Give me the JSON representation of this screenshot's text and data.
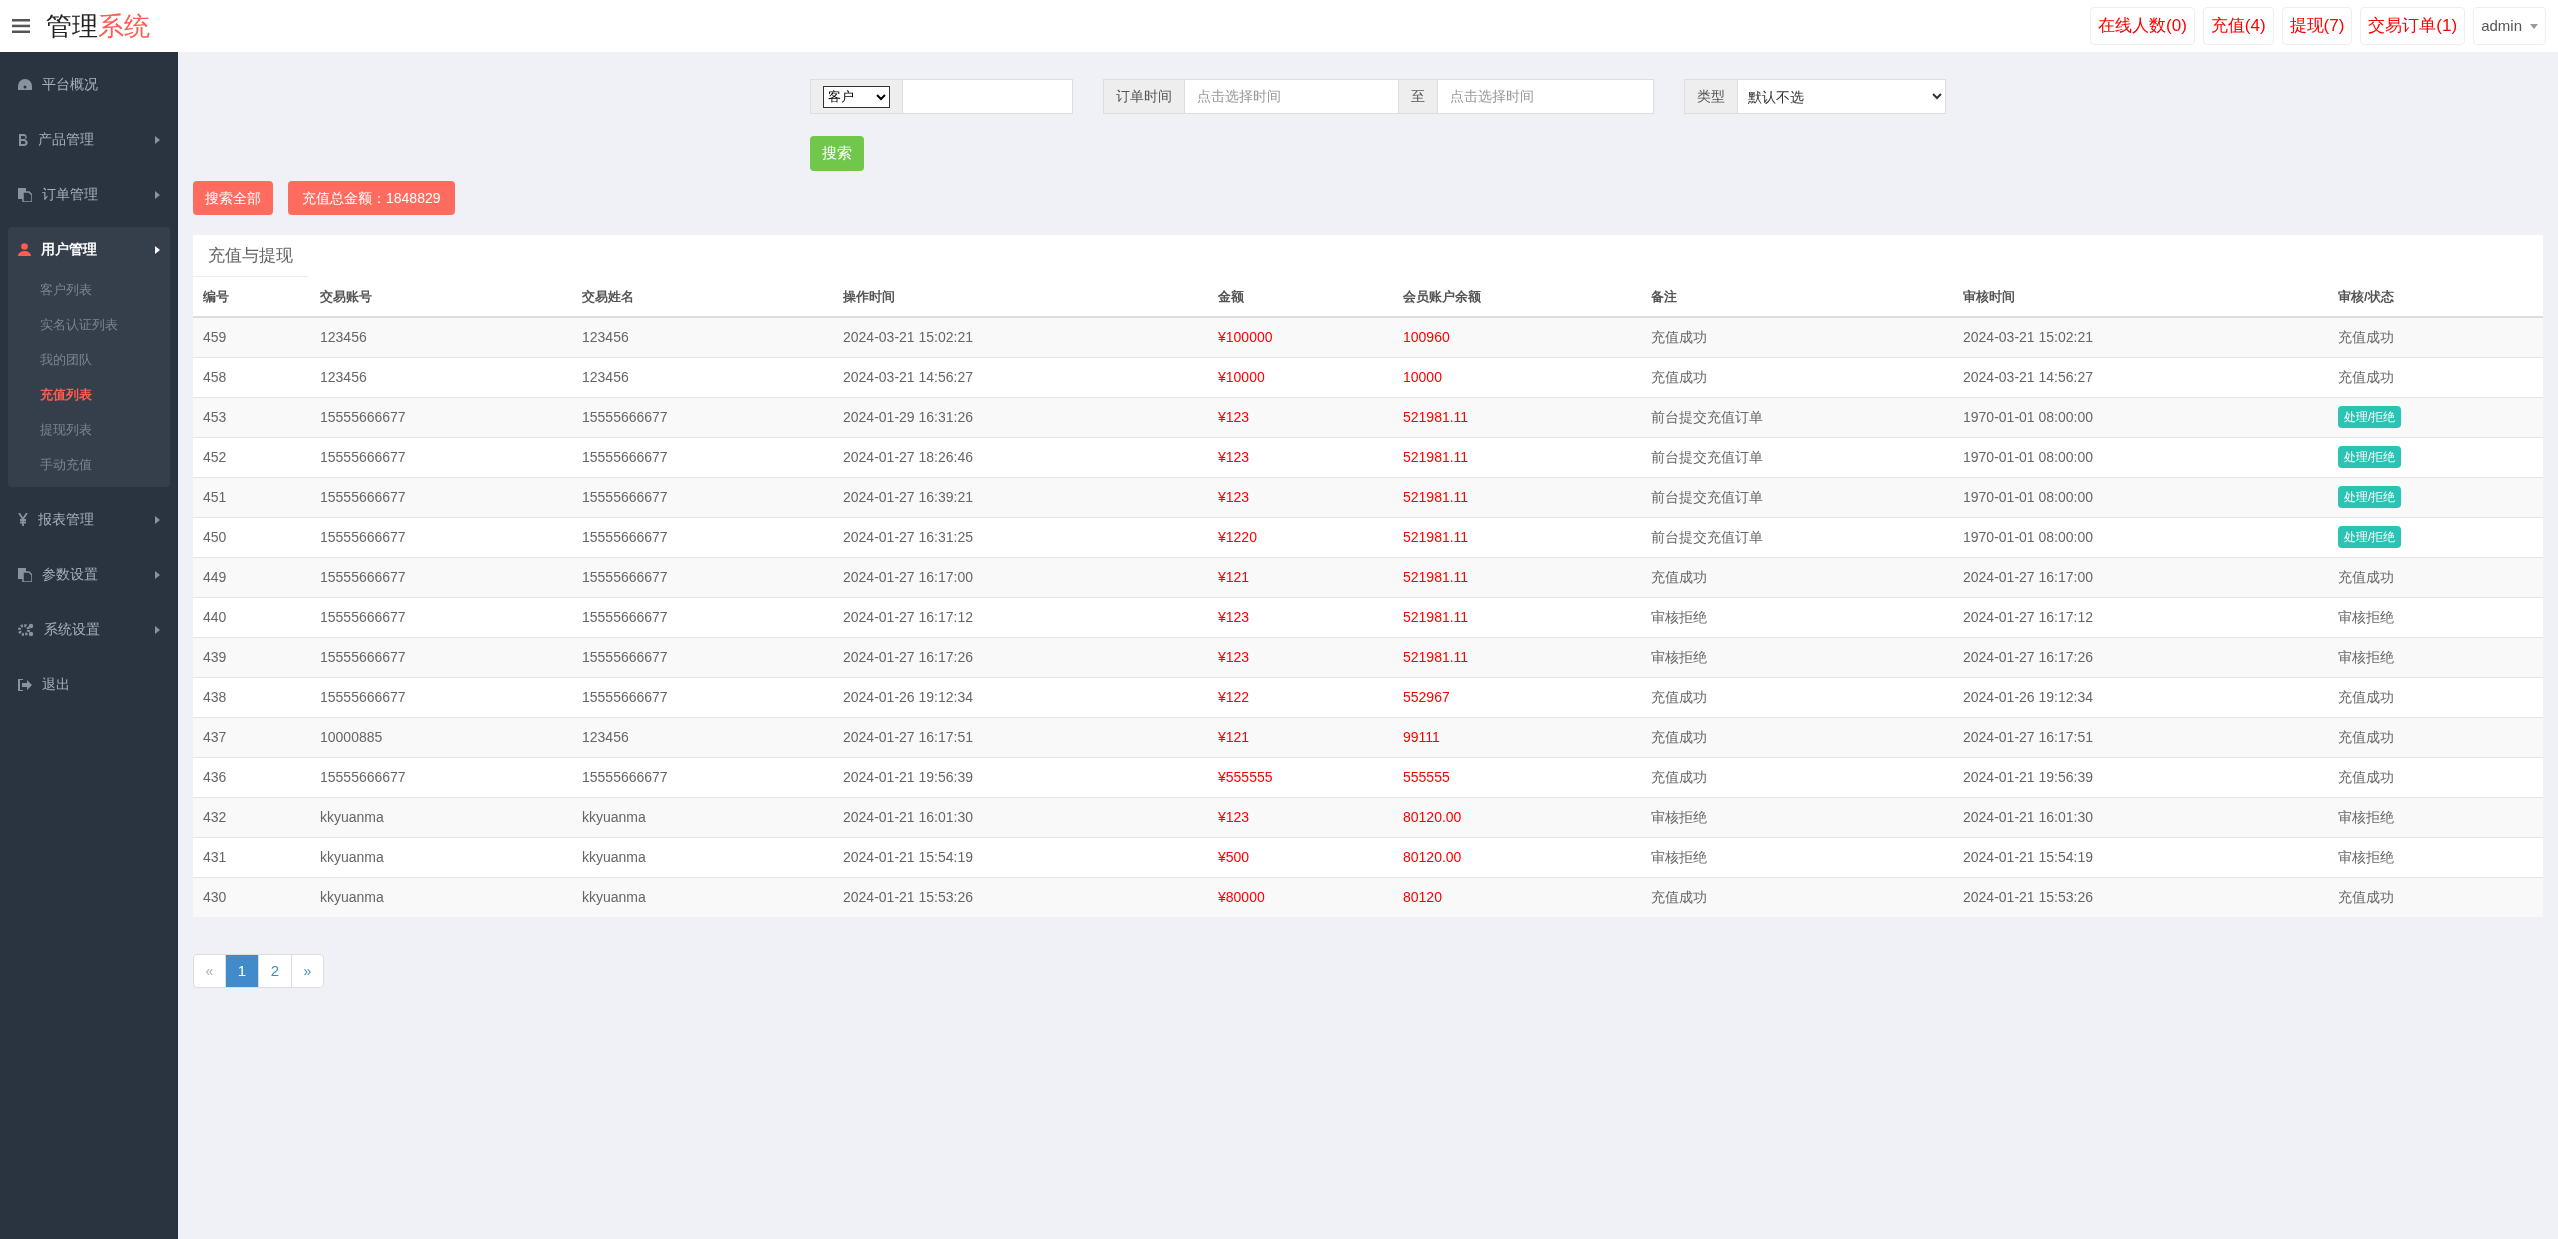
{
  "header": {
    "title_main": "管理",
    "title_accent": "系统",
    "badges": [
      "在线人数(0)",
      "充值(4)",
      "提现(7)",
      "交易订单(1)"
    ],
    "user": "admin"
  },
  "sidebar": {
    "items": [
      {
        "label": "平台概况",
        "kind": "link",
        "expanded": false
      },
      {
        "label": "产品管理",
        "kind": "menu",
        "expanded": false
      },
      {
        "label": "订单管理",
        "kind": "menu",
        "expanded": false
      },
      {
        "label": "用户管理",
        "kind": "menu",
        "expanded": true,
        "children": [
          {
            "label": "客户列表",
            "selected": false
          },
          {
            "label": "实名认证列表",
            "selected": false
          },
          {
            "label": "我的团队",
            "selected": false
          },
          {
            "label": "充值列表",
            "selected": true
          },
          {
            "label": "提现列表",
            "selected": false
          },
          {
            "label": "手动充值",
            "selected": false
          }
        ]
      },
      {
        "label": "报表管理",
        "kind": "menu",
        "expanded": false
      },
      {
        "label": "参数设置",
        "kind": "menu",
        "expanded": false
      },
      {
        "label": "系统设置",
        "kind": "menu",
        "expanded": false
      },
      {
        "label": "退出",
        "kind": "link",
        "expanded": false
      }
    ]
  },
  "filters": {
    "customer_select": "客户",
    "order_time_label": "订单时间",
    "start_placeholder": "点击选择时间",
    "to_label": "至",
    "end_placeholder": "点击选择时间",
    "type_label": "类型",
    "type_select": "默认不选",
    "search_button": "搜索"
  },
  "actions": {
    "search_all": "搜索全部",
    "total": "充值总金额：1848829"
  },
  "table": {
    "title": "充值与提现",
    "columns": [
      "编号",
      "交易账号",
      "交易姓名",
      "操作时间",
      "金额",
      "会员账户余额",
      "备注",
      "审核时间",
      "审核/状态"
    ],
    "rows": [
      {
        "cells": [
          "459",
          "123456",
          "123456",
          "2024-03-21 15:02:21",
          "¥100000",
          "100960",
          "充值成功",
          "2024-03-21 15:02:21"
        ],
        "status": {
          "kind": "text",
          "label": "充值成功"
        }
      },
      {
        "cells": [
          "458",
          "123456",
          "123456",
          "2024-03-21 14:56:27",
          "¥10000",
          "10000",
          "充值成功",
          "2024-03-21 14:56:27"
        ],
        "status": {
          "kind": "text",
          "label": "充值成功"
        }
      },
      {
        "cells": [
          "453",
          "15555666677",
          "15555666677",
          "2024-01-29 16:31:26",
          "¥123",
          "521981.11",
          "前台提交充值订单",
          "1970-01-01 08:00:00"
        ],
        "status": {
          "kind": "button",
          "label": "处理/拒绝"
        }
      },
      {
        "cells": [
          "452",
          "15555666677",
          "15555666677",
          "2024-01-27 18:26:46",
          "¥123",
          "521981.11",
          "前台提交充值订单",
          "1970-01-01 08:00:00"
        ],
        "status": {
          "kind": "button",
          "label": "处理/拒绝"
        }
      },
      {
        "cells": [
          "451",
          "15555666677",
          "15555666677",
          "2024-01-27 16:39:21",
          "¥123",
          "521981.11",
          "前台提交充值订单",
          "1970-01-01 08:00:00"
        ],
        "status": {
          "kind": "button",
          "label": "处理/拒绝"
        }
      },
      {
        "cells": [
          "450",
          "15555666677",
          "15555666677",
          "2024-01-27 16:31:25",
          "¥1220",
          "521981.11",
          "前台提交充值订单",
          "1970-01-01 08:00:00"
        ],
        "status": {
          "kind": "button",
          "label": "处理/拒绝"
        }
      },
      {
        "cells": [
          "449",
          "15555666677",
          "15555666677",
          "2024-01-27 16:17:00",
          "¥121",
          "521981.11",
          "充值成功",
          "2024-01-27 16:17:00"
        ],
        "status": {
          "kind": "text",
          "label": "充值成功"
        }
      },
      {
        "cells": [
          "440",
          "15555666677",
          "15555666677",
          "2024-01-27 16:17:12",
          "¥123",
          "521981.11",
          "审核拒绝",
          "2024-01-27 16:17:12"
        ],
        "status": {
          "kind": "text",
          "label": "审核拒绝"
        }
      },
      {
        "cells": [
          "439",
          "15555666677",
          "15555666677",
          "2024-01-27 16:17:26",
          "¥123",
          "521981.11",
          "审核拒绝",
          "2024-01-27 16:17:26"
        ],
        "status": {
          "kind": "text",
          "label": "审核拒绝"
        }
      },
      {
        "cells": [
          "438",
          "15555666677",
          "15555666677",
          "2024-01-26 19:12:34",
          "¥122",
          "552967",
          "充值成功",
          "2024-01-26 19:12:34"
        ],
        "status": {
          "kind": "text",
          "label": "充值成功"
        }
      },
      {
        "cells": [
          "437",
          "10000885",
          "123456",
          "2024-01-27 16:17:51",
          "¥121",
          "99111",
          "充值成功",
          "2024-01-27 16:17:51"
        ],
        "status": {
          "kind": "text",
          "label": "充值成功"
        }
      },
      {
        "cells": [
          "436",
          "15555666677",
          "15555666677",
          "2024-01-21 19:56:39",
          "¥555555",
          "555555",
          "充值成功",
          "2024-01-21 19:56:39"
        ],
        "status": {
          "kind": "text",
          "label": "充值成功"
        }
      },
      {
        "cells": [
          "432",
          "kkyuanma",
          "kkyuanma",
          "2024-01-21 16:01:30",
          "¥123",
          "80120.00",
          "审核拒绝",
          "2024-01-21 16:01:30"
        ],
        "status": {
          "kind": "text",
          "label": "审核拒绝"
        }
      },
      {
        "cells": [
          "431",
          "kkyuanma",
          "kkyuanma",
          "2024-01-21 15:54:19",
          "¥500",
          "80120.00",
          "审核拒绝",
          "2024-01-21 15:54:19"
        ],
        "status": {
          "kind": "text",
          "label": "审核拒绝"
        }
      },
      {
        "cells": [
          "430",
          "kkyuanma",
          "kkyuanma",
          "2024-01-21 15:53:26",
          "¥80000",
          "80120",
          "充值成功",
          "2024-01-21 15:53:26"
        ],
        "status": {
          "kind": "text",
          "label": "充值成功"
        }
      }
    ]
  },
  "pagination": {
    "prev": "«",
    "pages": [
      {
        "label": "1",
        "selected": true
      },
      {
        "label": "2",
        "selected": false
      }
    ],
    "next": "»"
  }
}
